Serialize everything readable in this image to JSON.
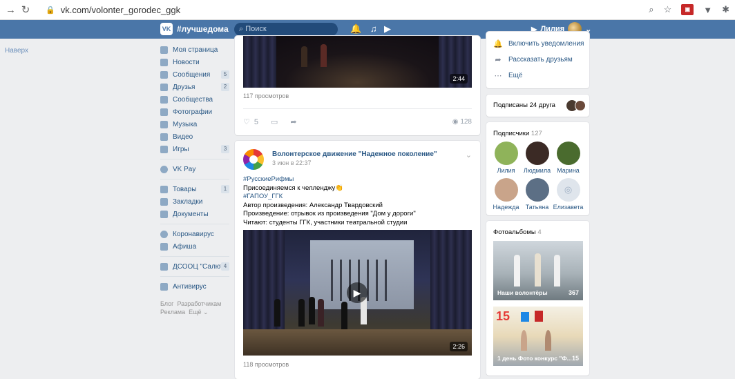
{
  "browser": {
    "url": "vk.com/volonter_gorodec_ggk"
  },
  "header": {
    "logo_text": "#лучшедома",
    "search_placeholder": "Поиск",
    "user_name": "Лилия"
  },
  "upnav": "Наверх",
  "menu": {
    "items": [
      {
        "label": "Моя страница"
      },
      {
        "label": "Новости"
      },
      {
        "label": "Сообщения",
        "count": "5"
      },
      {
        "label": "Друзья",
        "count": "2"
      },
      {
        "label": "Сообщества"
      },
      {
        "label": "Фотографии"
      },
      {
        "label": "Музыка"
      },
      {
        "label": "Видео"
      },
      {
        "label": "Игры",
        "count": "3"
      }
    ],
    "pay": "VK Pay",
    "items2": [
      {
        "label": "Товары",
        "count": "1"
      },
      {
        "label": "Закладки"
      },
      {
        "label": "Документы"
      }
    ],
    "items3": [
      {
        "label": "Коронавирус"
      },
      {
        "label": "Афиша"
      }
    ],
    "group": {
      "label": "ДСООЦ \"Салют\"",
      "count": "4"
    },
    "antivirus": "Антивирус",
    "footer": {
      "blog": "Блог",
      "dev": "Разработчикам",
      "ads": "Реклама",
      "more": "Ещё ⌄"
    }
  },
  "post1": {
    "duration": "2:44",
    "views": "117 просмотров",
    "likes": "5",
    "view_count": "128"
  },
  "post2": {
    "author": "Волонтерское движение \"Надежное поколение\"",
    "date": "3 июн в 22:37",
    "lines": [
      {
        "text": "#РусскиеРифмы",
        "tag": true
      },
      {
        "text": "Присоединяемся к челленджу👏"
      },
      {
        "text": "#ГАПОУ_ГГК",
        "tag": true
      },
      {
        "text": "Автор произведения: Александр Твардовский"
      },
      {
        "text": "Произведение: отрывок из произведения \"Дом у дороги\""
      },
      {
        "text": "Читают: студенты ГГК, участники театральной студии"
      }
    ],
    "duration": "2:26",
    "views": "118 просмотров"
  },
  "sidebar": {
    "notify": "Включить уведомления",
    "share": "Рассказать друзьям",
    "more": "Ещё",
    "subscribed": "Подписаны 24 друга",
    "followers_label": "Подписчики",
    "followers_count": "127",
    "followers": [
      {
        "name": "Лилия",
        "color": "#8fb35a"
      },
      {
        "name": "Людмила",
        "color": "#3b2a25"
      },
      {
        "name": "Марина",
        "color": "#4a6b2e"
      },
      {
        "name": "Надежда",
        "color": "#c9a48a"
      },
      {
        "name": "Татьяна",
        "color": "#5c6f85"
      },
      {
        "name": "Елизавета",
        "color": "#dfe5ec"
      }
    ],
    "albums_label": "Фотоальбомы",
    "albums_count": "4",
    "albums": [
      {
        "title": "Наши волонтёры",
        "count": "367"
      },
      {
        "title": "1 день Фото конкурс \"Ф...",
        "count": "15"
      }
    ]
  }
}
